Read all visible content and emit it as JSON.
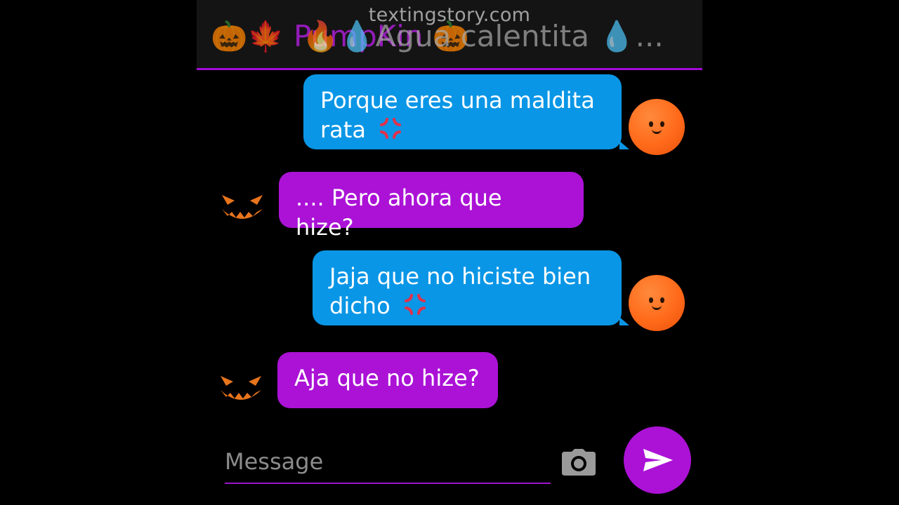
{
  "watermark": "textingstory.com",
  "header": {
    "name_a": "🎃🍁 PumpKin 🎃",
    "name_b": "🔥💧Agua calentita 💧...",
    "accent_color": "#a20bd6"
  },
  "messages": [
    {
      "side": "right",
      "color": "blue",
      "text": "Porque eres una maldita rata",
      "emoji": "anger-icon",
      "avatar": "orange-face"
    },
    {
      "side": "left",
      "color": "purple",
      "text": ".... Pero ahora que hize?",
      "avatar": "pumpkin-face"
    },
    {
      "side": "right",
      "color": "blue",
      "text": "Jaja que no hiciste bien dicho",
      "emoji": "anger-icon",
      "avatar": "orange-face"
    },
    {
      "side": "left",
      "color": "purple",
      "text": "Aja que no hize?",
      "avatar": "pumpkin-face"
    }
  ],
  "composer": {
    "placeholder": "Message",
    "camera_icon": "camera-icon",
    "send_icon": "send-icon"
  },
  "colors": {
    "blue_bubble": "#0a96e6",
    "purple_bubble": "#ab12d6",
    "background": "#000000"
  }
}
